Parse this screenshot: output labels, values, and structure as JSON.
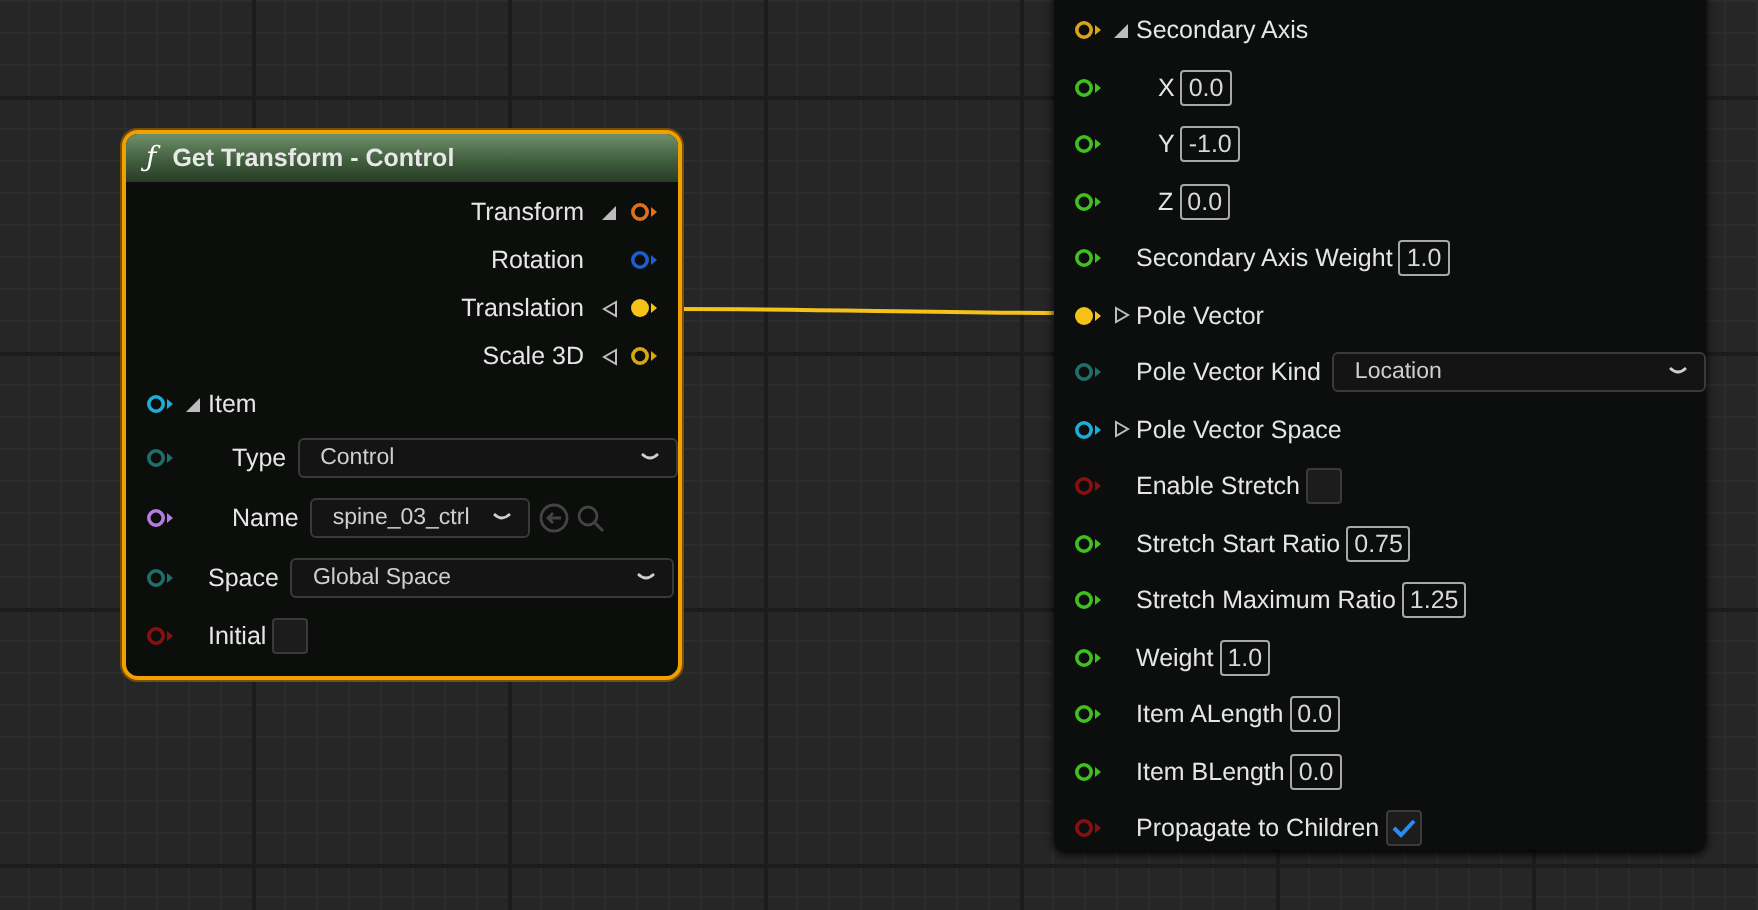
{
  "left_node": {
    "icon_glyph": "ƒ",
    "title": "Get Transform - Control",
    "outputs": [
      {
        "label": "Transform",
        "color": "#e0701a",
        "connected": false,
        "expanded": true
      },
      {
        "label": "Rotation",
        "color": "#1a5fd0",
        "connected": false
      },
      {
        "label": "Translation",
        "color": "#f5c21a",
        "connected": true,
        "expanded": false
      },
      {
        "label": "Scale 3D",
        "color": "#d8a80f",
        "connected": false,
        "expanded": false
      }
    ],
    "inputs": [
      {
        "kind": "struct",
        "label": "Item",
        "color": "#1aaed8",
        "connected": false,
        "expanded": true,
        "children": [
          {
            "kind": "enum",
            "label": "Type",
            "color": "#1f6f6a",
            "connected": false,
            "value": "Control"
          },
          {
            "kind": "name",
            "label": "Name",
            "color": "#b57be0",
            "connected": false,
            "value": "spine_03_ctrl"
          }
        ]
      },
      {
        "kind": "enum",
        "label": "Space",
        "color": "#1f6f6a",
        "connected": false,
        "value": "Global Space"
      },
      {
        "kind": "bool",
        "label": "Initial",
        "color": "#8a1010",
        "connected": false,
        "checked": false
      }
    ]
  },
  "right_node": {
    "inputs": [
      {
        "kind": "struct",
        "label": "Secondary Axis",
        "color": "#d9a41a",
        "connected": false,
        "expanded": true,
        "children": [
          {
            "kind": "float",
            "label": "X",
            "color": "#40c020",
            "connected": false,
            "value": "0.0"
          },
          {
            "kind": "float",
            "label": "Y",
            "color": "#40c020",
            "connected": false,
            "value": "-1.0"
          },
          {
            "kind": "float",
            "label": "Z",
            "color": "#40c020",
            "connected": false,
            "value": "0.0"
          }
        ]
      },
      {
        "kind": "float",
        "label": "Secondary Axis Weight",
        "color": "#40c020",
        "connected": false,
        "value": "1.0"
      },
      {
        "kind": "struct",
        "label": "Pole Vector",
        "color": "#f5c21a",
        "connected": true,
        "expanded": false
      },
      {
        "kind": "enum",
        "label": "Pole Vector Kind",
        "color": "#1f6f6a",
        "connected": false,
        "value": "Location"
      },
      {
        "kind": "struct",
        "label": "Pole Vector Space",
        "color": "#1aaed8",
        "connected": false,
        "expanded": false
      },
      {
        "kind": "bool",
        "label": "Enable Stretch",
        "color": "#8a1010",
        "connected": false,
        "checked": false
      },
      {
        "kind": "float",
        "label": "Stretch Start Ratio",
        "color": "#40c020",
        "connected": false,
        "value": "0.75"
      },
      {
        "kind": "float",
        "label": "Stretch Maximum Ratio",
        "color": "#40c020",
        "connected": false,
        "value": "1.25"
      },
      {
        "kind": "float",
        "label": "Weight",
        "color": "#40c020",
        "connected": false,
        "value": "1.0"
      },
      {
        "kind": "float",
        "label": "Item ALength",
        "color": "#40c020",
        "connected": false,
        "value": "0.0"
      },
      {
        "kind": "float",
        "label": "Item BLength",
        "color": "#40c020",
        "connected": false,
        "value": "0.0"
      },
      {
        "kind": "bool",
        "label": "Propagate to Children",
        "color": "#8a1010",
        "connected": false,
        "checked": true
      }
    ]
  }
}
